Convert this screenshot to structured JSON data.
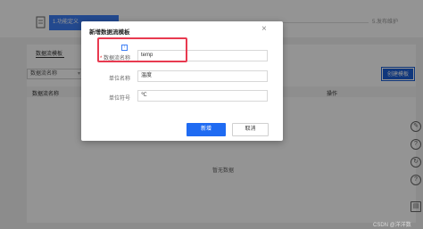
{
  "steps": {
    "step1_label": "1.功能定义",
    "step_last_label": "5.发布维护"
  },
  "content": {
    "tab_label": "数据流模板",
    "filter_label": "数据流名称",
    "create_button": "创建模板",
    "columns": {
      "name": "数据流名称",
      "ops": "操作"
    },
    "empty_text": "暂无数据"
  },
  "modal": {
    "title": "新增数据流模板",
    "close_icon": "×",
    "fields": [
      {
        "label": "数据流名称",
        "required": "*",
        "value": "temp"
      },
      {
        "label": "单位名称",
        "value": "温度"
      },
      {
        "label": "单位符号",
        "value": "℃"
      }
    ],
    "ok_button": "新增",
    "cancel_button": "取消"
  },
  "tools": [
    "✎",
    "?",
    "↻",
    "?",
    "▤"
  ],
  "watermark": "CSDN @洋洋数"
}
